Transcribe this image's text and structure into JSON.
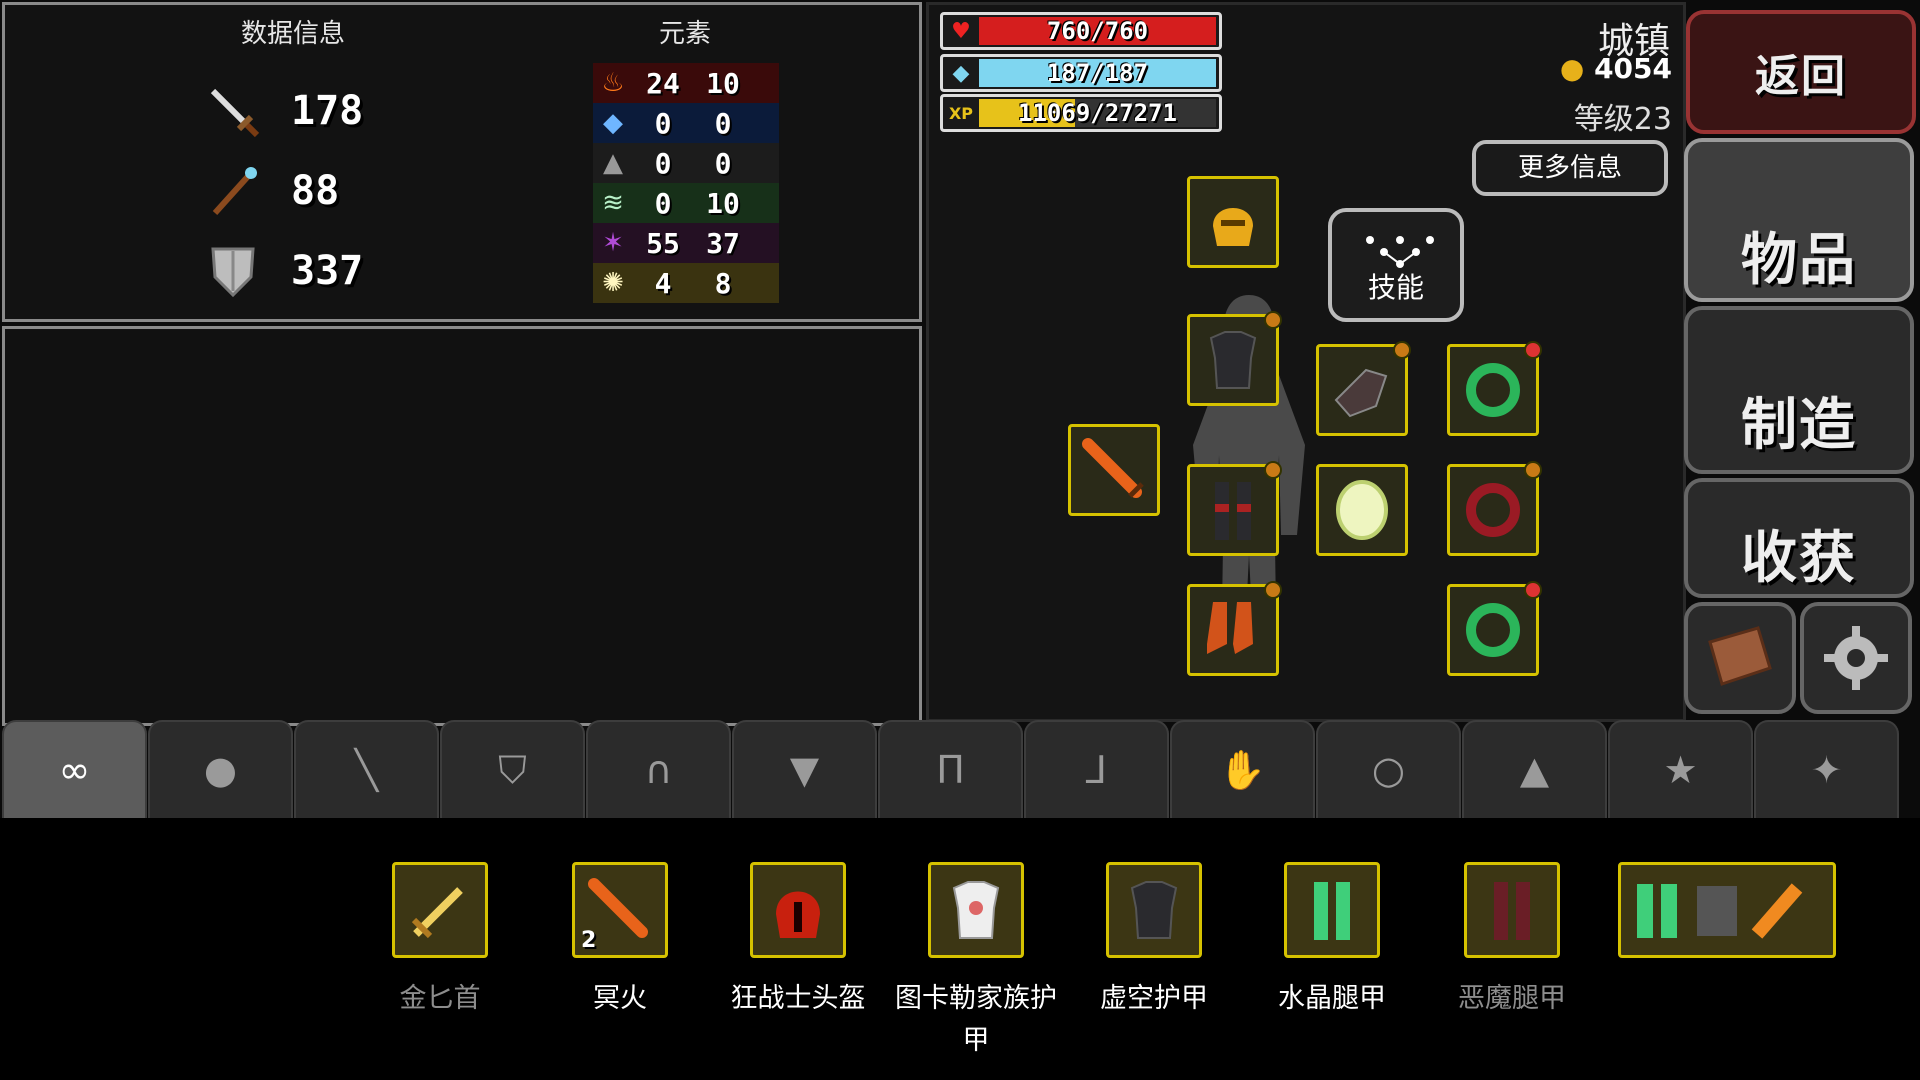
{
  "stats": {
    "header": "数据信息",
    "attack": "178",
    "magic": "88",
    "defense": "337"
  },
  "elements": {
    "header": "元素",
    "rows": [
      {
        "icon": "fire-icon",
        "a": "24",
        "b": "10",
        "color": "#3a0a0a"
      },
      {
        "icon": "ice-icon",
        "a": "0",
        "b": "0",
        "color": "#0b1b3a"
      },
      {
        "icon": "rock-icon",
        "a": "0",
        "b": "0",
        "color": "#1c1c1c"
      },
      {
        "icon": "wind-icon",
        "a": "0",
        "b": "10",
        "color": "#173019"
      },
      {
        "icon": "dark-icon",
        "a": "55",
        "b": "37",
        "color": "#241023"
      },
      {
        "icon": "holy-icon",
        "a": "4",
        "b": "8",
        "color": "#3a3310"
      }
    ]
  },
  "bars": {
    "hp": {
      "text": "760/760",
      "fraction": 1.0,
      "color": "#d51e1e"
    },
    "mp": {
      "text": "187/187",
      "fraction": 1.0,
      "color": "#7fd6f0"
    },
    "xp": {
      "label": "XP",
      "text": "11069/27271",
      "fraction": 0.406,
      "color": "#e7c21a"
    }
  },
  "player": {
    "location": "城镇",
    "gold": "4054",
    "level": "等级23"
  },
  "buttons": {
    "more_info": "更多信息",
    "skills": "技能",
    "back": "返回",
    "items": "物品",
    "craft": "制造",
    "harvest": "收获"
  },
  "tabs": {
    "active_label": "所有",
    "icons": [
      "infinity-icon",
      "bag-icon",
      "sword-icon",
      "shield-icon",
      "helmet-icon",
      "armor-icon",
      "legs-icon",
      "boots-icon",
      "gloves-icon",
      "ring-icon",
      "hat-icon",
      "star-icon",
      "wand-icon"
    ]
  },
  "inventory": [
    {
      "name": "金匕首",
      "dim": true
    },
    {
      "name": "冥火",
      "dim": false,
      "count": "2"
    },
    {
      "name": "狂战士头盔",
      "dim": false
    },
    {
      "name": "图卡勒家族护甲",
      "dim": false
    },
    {
      "name": "虚空护甲",
      "dim": false
    },
    {
      "name": "水晶腿甲",
      "dim": false
    },
    {
      "name": "恶魔腿甲",
      "dim": true
    }
  ]
}
